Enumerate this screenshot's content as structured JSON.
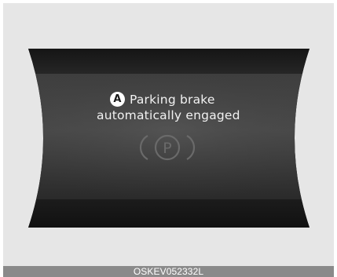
{
  "display": {
    "marker_letter": "A",
    "message_line1": "Parking brake",
    "message_line2": "automatically engaged",
    "icon": "parking-brake-icon",
    "icon_letter": "P"
  },
  "caption": {
    "code": "OSKEV052332L"
  },
  "colors": {
    "background_panel": "#e6e6e6",
    "display_dark": "#1e1e1e",
    "text": "#f2f2f2",
    "icon_gray": "#6a6a6a",
    "caption_bar": "#8a8a8a"
  }
}
